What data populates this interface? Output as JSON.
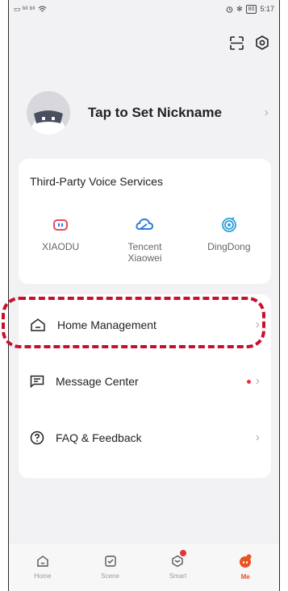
{
  "status_bar": {
    "left_text": "▭ ᵇⁱˡ ᵇⁱˡ",
    "time": "5:17",
    "battery": "80"
  },
  "profile": {
    "nickname": "Tap to Set Nickname"
  },
  "voice_services": {
    "title": "Third-Party Voice Services",
    "items": [
      {
        "label": "XIAODU",
        "icon": "xiaodu-icon",
        "color": "#e84a5f"
      },
      {
        "label": "Tencent Xiaowei",
        "icon": "tencent-cloud-icon",
        "color": "#2a7de1"
      },
      {
        "label": "DingDong",
        "icon": "dingdong-icon",
        "color": "#2a9fd8"
      }
    ]
  },
  "menu": {
    "items": [
      {
        "label": "Home Management",
        "icon": "home-icon",
        "has_dot": false
      },
      {
        "label": "Message Center",
        "icon": "message-icon",
        "has_dot": true
      },
      {
        "label": "FAQ & Feedback",
        "icon": "question-icon",
        "has_dot": false
      }
    ]
  },
  "tab_bar": {
    "tabs": [
      {
        "label": "Home",
        "icon": "home-icon",
        "active": false
      },
      {
        "label": "Scene",
        "icon": "scene-icon",
        "active": false
      },
      {
        "label": "Smart",
        "icon": "smart-icon",
        "active": false,
        "badge": true
      },
      {
        "label": "Me",
        "icon": "me-icon",
        "active": true
      }
    ]
  },
  "colors": {
    "accent": "#e8531f",
    "highlight": "#c8102e",
    "notification_dot": "#e6333a"
  }
}
